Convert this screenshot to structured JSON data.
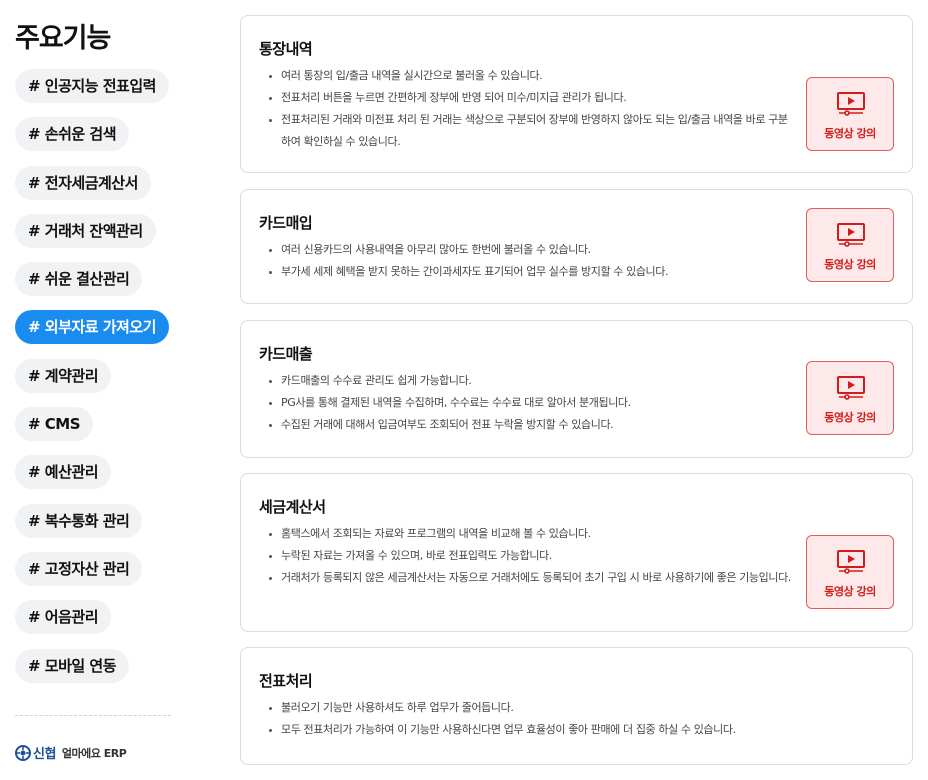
{
  "sidebar": {
    "title": "주요기능",
    "items": [
      {
        "label": "# 인공지능 전표입력"
      },
      {
        "label": "# 손쉬운 검색"
      },
      {
        "label": "# 전자세금계산서"
      },
      {
        "label": "# 거래처 잔액관리"
      },
      {
        "label": "# 쉬운 결산관리"
      },
      {
        "label": "# 외부자료 가져오기"
      },
      {
        "label": "# 계약관리"
      },
      {
        "label": "# CMS"
      },
      {
        "label": "# 예산관리"
      },
      {
        "label": "# 복수통화 관리"
      },
      {
        "label": "# 고정자산 관리"
      },
      {
        "label": "# 어음관리"
      },
      {
        "label": "# 모바일 연동"
      }
    ],
    "active_index": 5,
    "logo": {
      "brand": "신협",
      "product": "얼마에요 ERP"
    }
  },
  "colors": {
    "active": "#1a8cf0",
    "video_border": "#e55a5a",
    "video_bg": "#fde9e9",
    "video_text": "#d21d1d"
  },
  "cards": [
    {
      "title": "통장내역",
      "bullets": [
        "여러 통장의 입/출금 내역을 실시간으로 불러올 수 있습니다.",
        "전표처리 버튼을 누르면 간편하게 장부에 반영 되어 미수/미지급 관리가 됩니다.",
        "전표처리된 거래와 미전표 처리 된 거래는 색상으로 구분되어 장부에 반영하지 않아도 되는 입/출금 내역을 바로 구분하여 확인하실 수 있습니다."
      ],
      "video_label": "동영상 강의"
    },
    {
      "title": "카드매입",
      "bullets": [
        "여러 신용카드의 사용내역을 아무리 많아도 한번에 불러올 수 있습니다.",
        "부가세 세제 혜택을 받지 못하는 간이과세자도 표기되어 업무 실수를 방지할 수 있습니다."
      ],
      "video_label": "동영상 강의"
    },
    {
      "title": "카드매출",
      "bullets": [
        "카드매출의 수수료 관리도 쉽게 가능합니다.",
        "PG사를 통해 결제된 내역을 수집하며, 수수료는 수수료 대로 알아서 분개됩니다.",
        "수집된 거래에 대해서 입금여부도 조회되어 전표 누락을 방지할 수 있습니다."
      ],
      "video_label": "동영상 강의"
    },
    {
      "title": "세금계산서",
      "bullets": [
        "홈택스에서 조회되는 자료와 프로그램의 내역을 비교해 볼 수 있습니다.",
        "누락된 자료는 가져올 수 있으며, 바로 전표입력도 가능합니다.",
        "거래처가 등록되지 않은 세금계산서는 자동으로 거래처에도 등록되어 초기 구입 시 바로 사용하기에 좋은 기능입니다."
      ],
      "video_label": "동영상 강의"
    },
    {
      "title": "전표처리",
      "bullets": [
        "불러오기 기능만 사용하셔도 하루 업무가 줄어듭니다.",
        "모두 전표처리가 가능하여 이 기능만 사용하신다면 업무 효율성이 좋아 판매에 더 집중 하실 수 있습니다."
      ],
      "video_label": ""
    }
  ]
}
